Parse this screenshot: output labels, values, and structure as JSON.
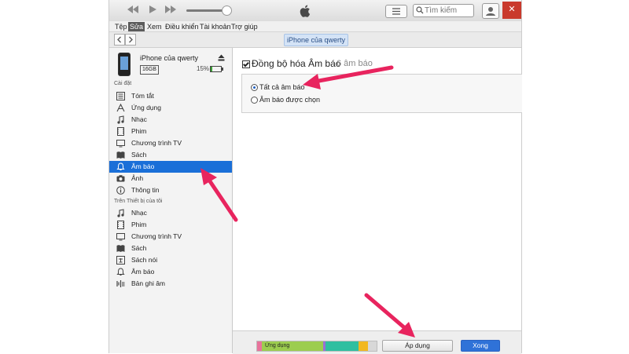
{
  "colors": {
    "accent": "#1a6fd8",
    "annotation": "#e8245e",
    "done_button": "#2f72d8"
  },
  "titlebar": {
    "icons": [
      "rewind-icon",
      "play-icon",
      "fast-forward-icon",
      "apple-icon",
      "list-view-icon",
      "search-icon",
      "account-icon"
    ],
    "search_placeholder": "Tìm kiếm"
  },
  "menu": {
    "items": [
      {
        "label": "Tệp",
        "active": false
      },
      {
        "label": "Sửa",
        "active": true
      },
      {
        "label": "Xem",
        "active": false
      },
      {
        "label": "Điều khiển",
        "active": false
      },
      {
        "label": "Tài khoản",
        "active": false
      },
      {
        "label": "Trợ giúp",
        "active": false
      }
    ]
  },
  "nav": {
    "device_pill": "iPhone của qwerty"
  },
  "device": {
    "name": "iPhone của qwerty",
    "capacity": "16GB",
    "battery": "15%",
    "battery_level": 0.15
  },
  "sidebar": {
    "settings_header": "Cài đặt",
    "settings_items": [
      {
        "label": "Tóm tắt",
        "icon": "summary-icon"
      },
      {
        "label": "Ứng dụng",
        "icon": "apps-icon"
      },
      {
        "label": "Nhạc",
        "icon": "music-icon"
      },
      {
        "label": "Phim",
        "icon": "film-icon"
      },
      {
        "label": "Chương trình TV",
        "icon": "tv-icon"
      },
      {
        "label": "Sách",
        "icon": "book-icon"
      },
      {
        "label": "Âm báo",
        "icon": "bell-icon",
        "selected": true
      },
      {
        "label": "Ảnh",
        "icon": "camera-icon"
      },
      {
        "label": "Thông tin",
        "icon": "info-icon"
      }
    ],
    "ondevice_header": "Trên Thiết bị của tôi",
    "ondevice_items": [
      {
        "label": "Nhạc",
        "icon": "music-icon"
      },
      {
        "label": "Phim",
        "icon": "film-icon"
      },
      {
        "label": "Chương trình TV",
        "icon": "tv-icon"
      },
      {
        "label": "Sách",
        "icon": "book-icon"
      },
      {
        "label": "Sách nói",
        "icon": "audiobook-icon"
      },
      {
        "label": "Âm báo",
        "icon": "bell-icon"
      },
      {
        "label": "Bản ghi âm",
        "icon": "voice-memo-icon"
      }
    ]
  },
  "main": {
    "sync_label": "Đồng bộ hóa Âm báo",
    "sync_count": "6 âm báo",
    "sync_checked": true,
    "options": [
      {
        "label": "Tất cả âm báo",
        "selected": true
      },
      {
        "label": "Âm báo được chọn",
        "selected": false
      }
    ]
  },
  "bottom": {
    "storage_label": "Ứng dụng",
    "storage_segments": [
      {
        "name": "other",
        "color": "#e8739c",
        "fraction": 0.04
      },
      {
        "name": "apps",
        "color": "#9ccd4f",
        "fraction": 0.51
      },
      {
        "name": "purple",
        "color": "#9a6fd8",
        "fraction": 0.02
      },
      {
        "name": "teal",
        "color": "#2fbfa0",
        "fraction": 0.28
      },
      {
        "name": "yellow",
        "color": "#f2b820",
        "fraction": 0.08
      },
      {
        "name": "free",
        "color": "#d8d8d8",
        "fraction": 0.07
      }
    ],
    "apply_label": "Áp dụng",
    "done_label": "Xong"
  }
}
